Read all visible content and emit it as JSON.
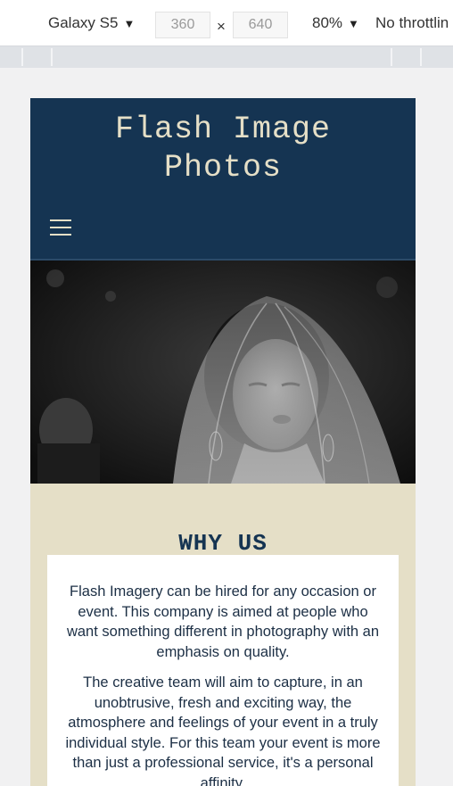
{
  "devtools": {
    "device": "Galaxy S5",
    "width": "360",
    "height": "640",
    "dimension_separator": "×",
    "zoom": "80%",
    "throttling": "No throttlin",
    "caret": "▼"
  },
  "site": {
    "title_line1": "Flash Image",
    "title_line2": "Photos",
    "menu_icon": "hamburger-icon"
  },
  "hero": {
    "image": "bride-in-veil-photo"
  },
  "why_us": {
    "heading": "WHY US",
    "paragraph1": "Flash Imagery can be hired for any occasion or event. This company is aimed at people who want something different in photography with an emphasis on quality.",
    "paragraph2": "The creative team will aim to capture, in an unobtrusive, fresh and exciting way, the atmosphere and feelings of your event in a truly individual style. For this team your event is more than just a professional service, it's a personal affinity."
  },
  "colors": {
    "header_bg": "#153452",
    "accent_cream": "#e5dfc7",
    "heading_navy": "#153452"
  }
}
